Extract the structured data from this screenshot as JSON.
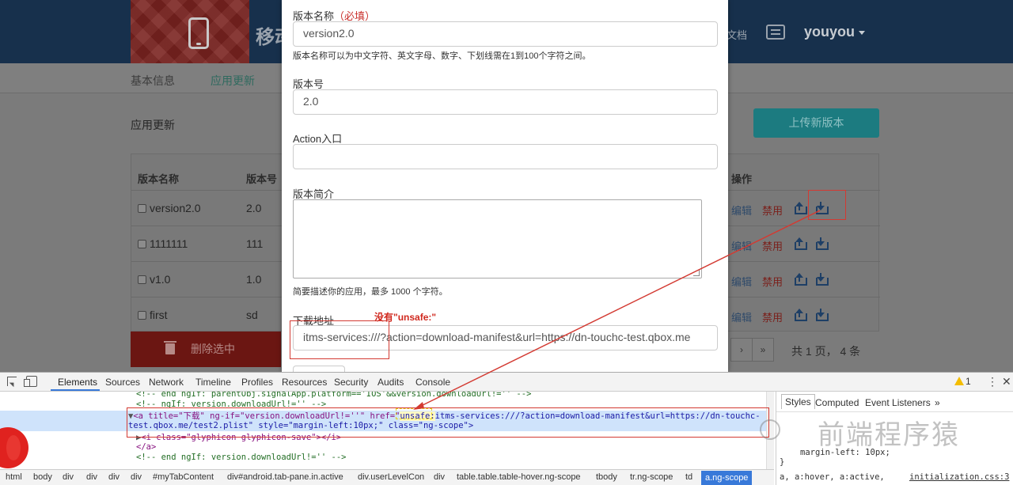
{
  "header": {
    "brand_title": "移动",
    "nav_doc": "文档",
    "user_name": "youyou"
  },
  "subnav": {
    "tabs": [
      {
        "label": "基本信息"
      },
      {
        "label": "应用更新"
      }
    ]
  },
  "page": {
    "section_title": "应用更新",
    "upload_button": "上传新版本",
    "delete_button": "删除选中",
    "page_info": "共 1 页， 4 条",
    "pager": [
      "›",
      "»"
    ]
  },
  "table": {
    "columns": [
      "版本名称",
      "版本号",
      "操作"
    ],
    "rows": [
      {
        "name": "version2.0",
        "code": "2.0",
        "edit": "编辑",
        "disable": "禁用"
      },
      {
        "name": "1111111",
        "code": "111",
        "edit": "编辑",
        "disable": "禁用"
      },
      {
        "name": "v1.0",
        "code": "1.0",
        "edit": "编辑",
        "disable": "禁用"
      },
      {
        "name": "first",
        "code": "sd",
        "edit": "编辑",
        "disable": "禁用"
      }
    ]
  },
  "modal": {
    "name_label": "版本名称",
    "name_required": "（必填）",
    "name_value": "version2.0",
    "name_help": "版本名称可以为中文字符、英文字母、数字、下划线需在1到100个字符之间。",
    "code_label": "版本号",
    "code_value": "2.0",
    "action_label": "Action入口",
    "action_value": "",
    "desc_label": "版本简介",
    "desc_help": "简要描述你的应用，最多 1000 个字符。",
    "download_label": "下载地址",
    "no_unsafe_note": "没有\"unsafe:\"",
    "download_value": "itms-services:///?action=download-manifest&url=https://dn-touchc-test.qbox.me"
  },
  "devtools": {
    "tabs": [
      "Elements",
      "Sources",
      "Network",
      "Timeline",
      "Profiles",
      "Resources",
      "Security",
      "Audits",
      "Console"
    ],
    "warning_count": "1",
    "lines": {
      "l1": "<!-- end ngIf: parentObj.signalApp.platform=='IOS'&&version.downloadUrl!='' -->",
      "l2": "<!-- ngIf: version.downloadUrl!='' -->",
      "l3_a": "<a title=\"下载\" ng-if=\"version.downloadUrl!=''\" href=\"",
      "l3_unsafe": "unsafe:",
      "l3_b": "itms-services:///?action=download-manifest&url=https://dn-touchc-",
      "l4": "test.qbox.me/test2.plist\" style=\"margin-left:10px;\" class=\"ng-scope\">",
      "l5": "<i class=\"glyphicon glyphicon-save\"></i>",
      "l6": "</a>",
      "l7": "<!-- end ngIf: version.downloadUrl!='' -->"
    },
    "styles_tabs": [
      "Styles",
      "Computed",
      "Event Listeners",
      "»"
    ],
    "styles_rule_1": "margin-left: 10px;",
    "styles_rule_2": "}",
    "styles_selector": "a, a:hover, a:active,",
    "styles_source": "initialization.css:3",
    "breadcrumb": [
      "html",
      "body",
      "div",
      "div",
      "div",
      "div",
      "#myTabContent",
      "div#android.tab-pane.in.active",
      "div.userLevelCon",
      "div",
      "table.table.table-hover.ng-scope",
      "tbody",
      "tr.ng-scope",
      "td",
      "a.ng-scope"
    ]
  },
  "watermark": "前端程序猿",
  "colors": {
    "annotation_red": "#d33a32",
    "accent_teal": "#1c7b80",
    "danger": "#c9302c"
  }
}
